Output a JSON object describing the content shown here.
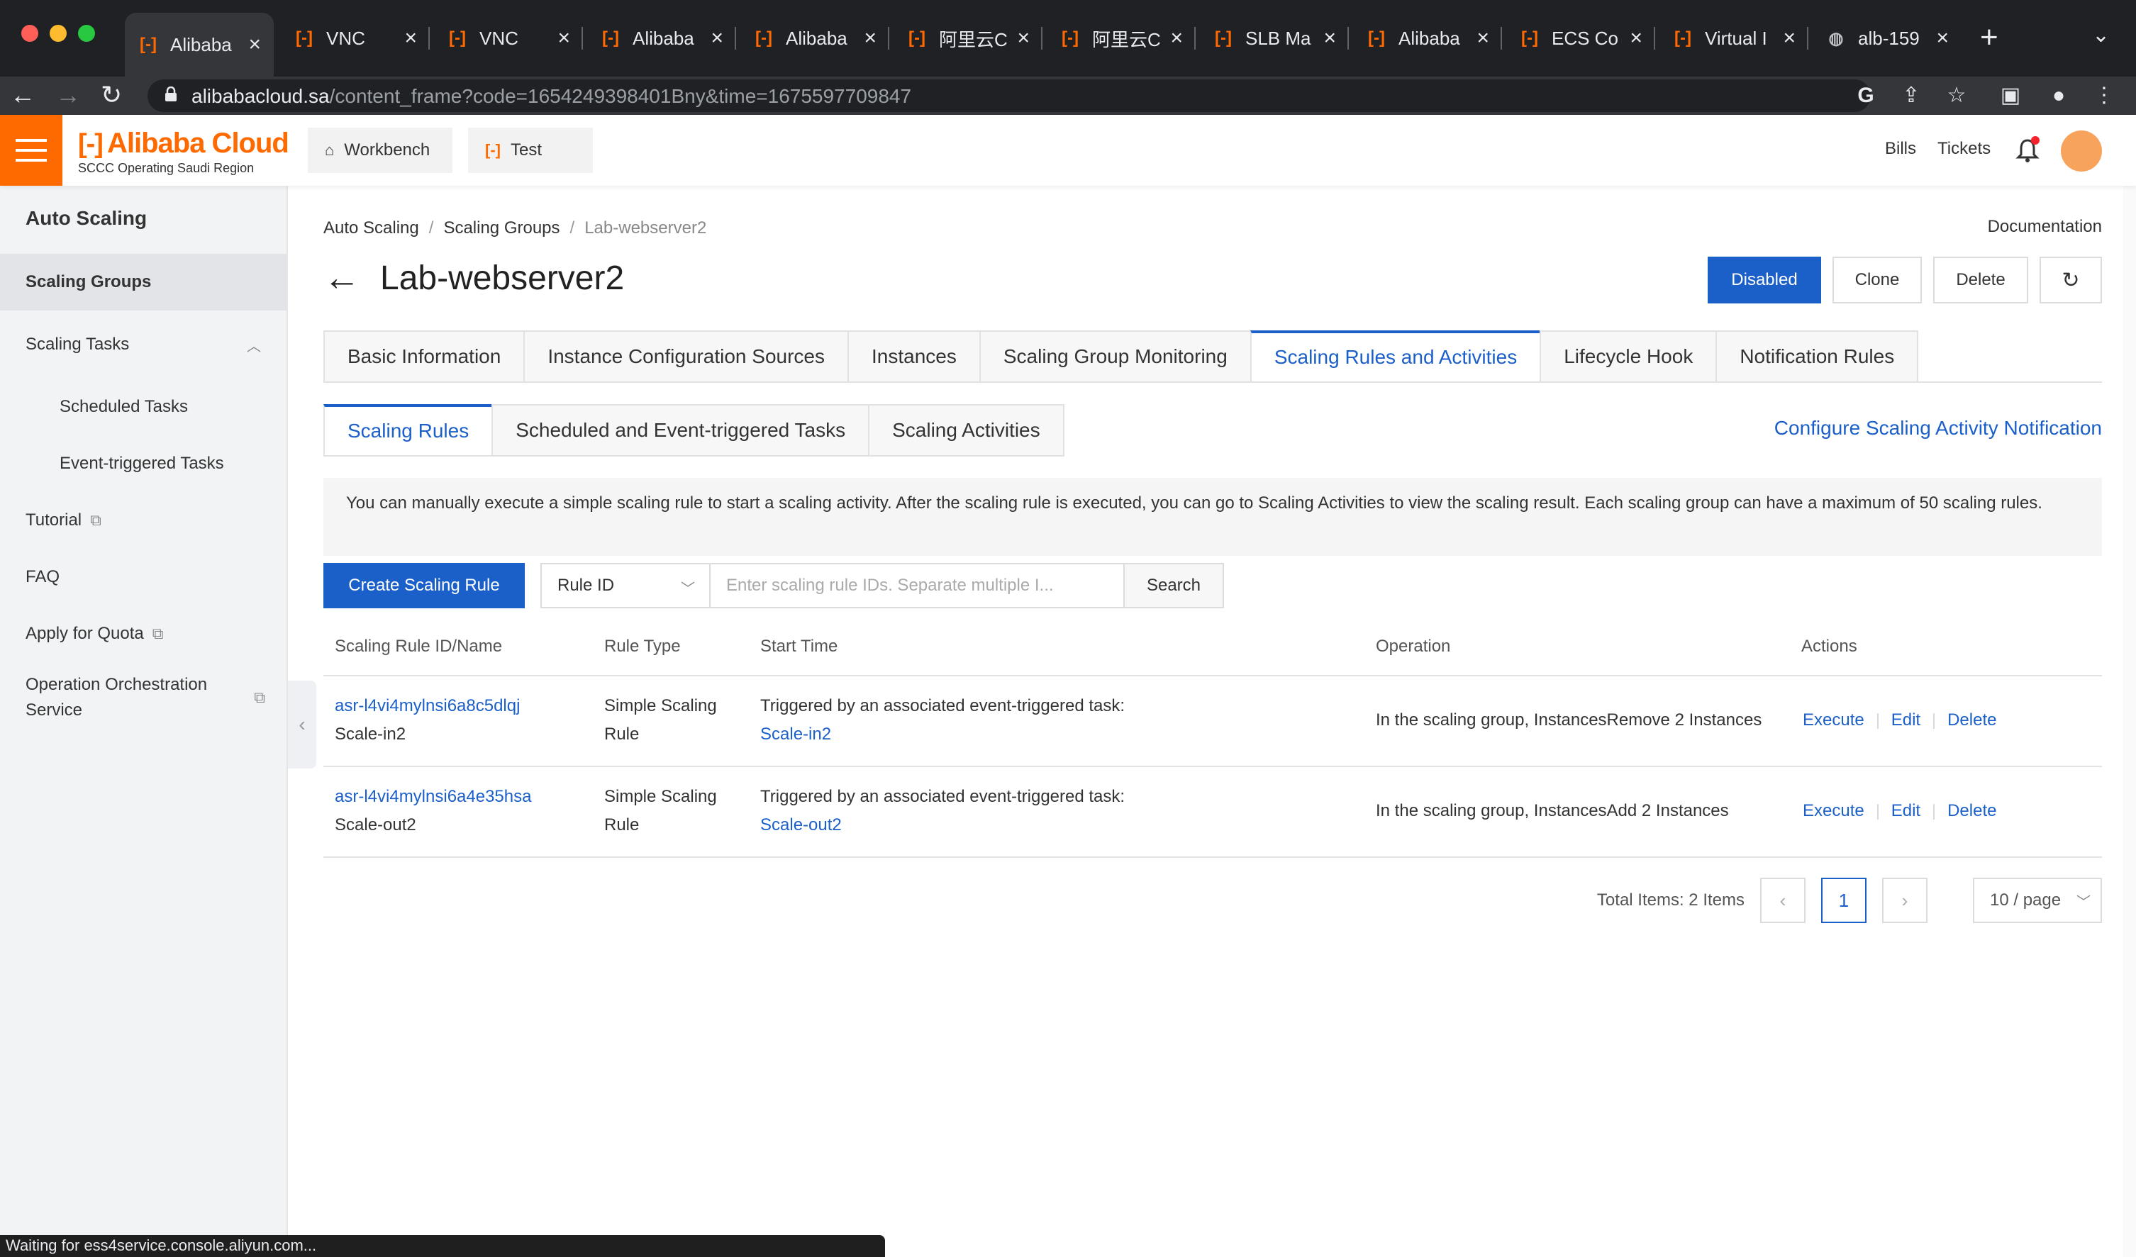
{
  "browser": {
    "tabs": [
      {
        "title": "Alibaba",
        "icon": "alibaba-icon",
        "active": true
      },
      {
        "title": "VNC",
        "icon": "alibaba-icon"
      },
      {
        "title": "VNC",
        "icon": "alibaba-icon"
      },
      {
        "title": "Alibaba",
        "icon": "alibaba-icon"
      },
      {
        "title": "Alibaba",
        "icon": "alibaba-icon"
      },
      {
        "title": "阿里云C",
        "icon": "alibaba-icon"
      },
      {
        "title": "阿里云C",
        "icon": "alibaba-icon"
      },
      {
        "title": "SLB Ma",
        "icon": "alibaba-icon"
      },
      {
        "title": "Alibaba",
        "icon": "alibaba-icon"
      },
      {
        "title": "ECS Co",
        "icon": "alibaba-icon"
      },
      {
        "title": "Virtual I",
        "icon": "alibaba-icon"
      },
      {
        "title": "alb-159",
        "icon": "globe-icon"
      }
    ],
    "url_domain": "alibabacloud.sa",
    "url_path": "/content_frame?code=1654249398401Bny&time=1675597709847",
    "status_text": "Waiting for ess4service.console.aliyun.com..."
  },
  "header": {
    "brand": "Alibaba Cloud",
    "region": "SCCC Operating Saudi Region",
    "workbench": "Workbench",
    "test": "Test",
    "bills": "Bills",
    "tickets": "Tickets",
    "accent_color": "#ff6a00"
  },
  "sidebar": {
    "title": "Auto Scaling",
    "items": [
      {
        "label": "Scaling Groups"
      },
      {
        "label": "Scaling Tasks"
      },
      {
        "label": "Scheduled Tasks"
      },
      {
        "label": "Event-triggered Tasks"
      },
      {
        "label": "Tutorial"
      },
      {
        "label": "FAQ"
      },
      {
        "label": "Apply for Quota"
      },
      {
        "label": "Operation Orchestration Service"
      }
    ]
  },
  "breadcrumb": [
    "Auto Scaling",
    "Scaling Groups",
    "Lab-webserver2"
  ],
  "documentation": "Documentation",
  "page_title": "Lab-webserver2",
  "actions": {
    "disabled": "Disabled",
    "clone": "Clone",
    "delete": "Delete"
  },
  "tabs": [
    "Basic Information",
    "Instance Configuration Sources",
    "Instances",
    "Scaling Group Monitoring",
    "Scaling Rules and Activities",
    "Lifecycle Hook",
    "Notification Rules"
  ],
  "subtabs": [
    "Scaling Rules",
    "Scheduled and Event-triggered Tasks",
    "Scaling Activities"
  ],
  "configure_link": "Configure Scaling Activity Notification",
  "notice": "You can manually execute a simple scaling rule to start a scaling activity. After the scaling rule is executed, you can go to Scaling Activities to view the scaling result. Each scaling group can have a maximum of 50 scaling rules.",
  "toolbar": {
    "create": "Create Scaling Rule",
    "filter": "Rule ID",
    "placeholder": "Enter scaling rule IDs. Separate multiple I...",
    "search": "Search"
  },
  "table": {
    "columns": [
      "Scaling Rule ID/Name",
      "Rule Type",
      "Start Time",
      "Operation",
      "Actions"
    ],
    "rows": [
      {
        "id": "asr-l4vi4mylnsi6a8c5dlqj",
        "name": "Scale-in2",
        "type_line1": "Simple Scaling",
        "type_line2": "Rule",
        "start_line1": "Triggered by an associated event-triggered task:",
        "start_task": "Scale-in2",
        "operation": "In the scaling group, InstancesRemove 2 Instances",
        "execute": "Execute",
        "edit": "Edit",
        "delete": "Delete"
      },
      {
        "id": "asr-l4vi4mylnsi6a4e35hsa",
        "name": "Scale-out2",
        "type_line1": "Simple Scaling",
        "type_line2": "Rule",
        "start_line1": "Triggered by an associated event-triggered task:",
        "start_task": "Scale-out2",
        "operation": "In the scaling group, InstancesAdd 2 Instances",
        "execute": "Execute",
        "edit": "Edit",
        "delete": "Delete"
      }
    ]
  },
  "pagination": {
    "total": "Total Items: 2 Items",
    "current": "1",
    "page_size": "10 / page"
  }
}
